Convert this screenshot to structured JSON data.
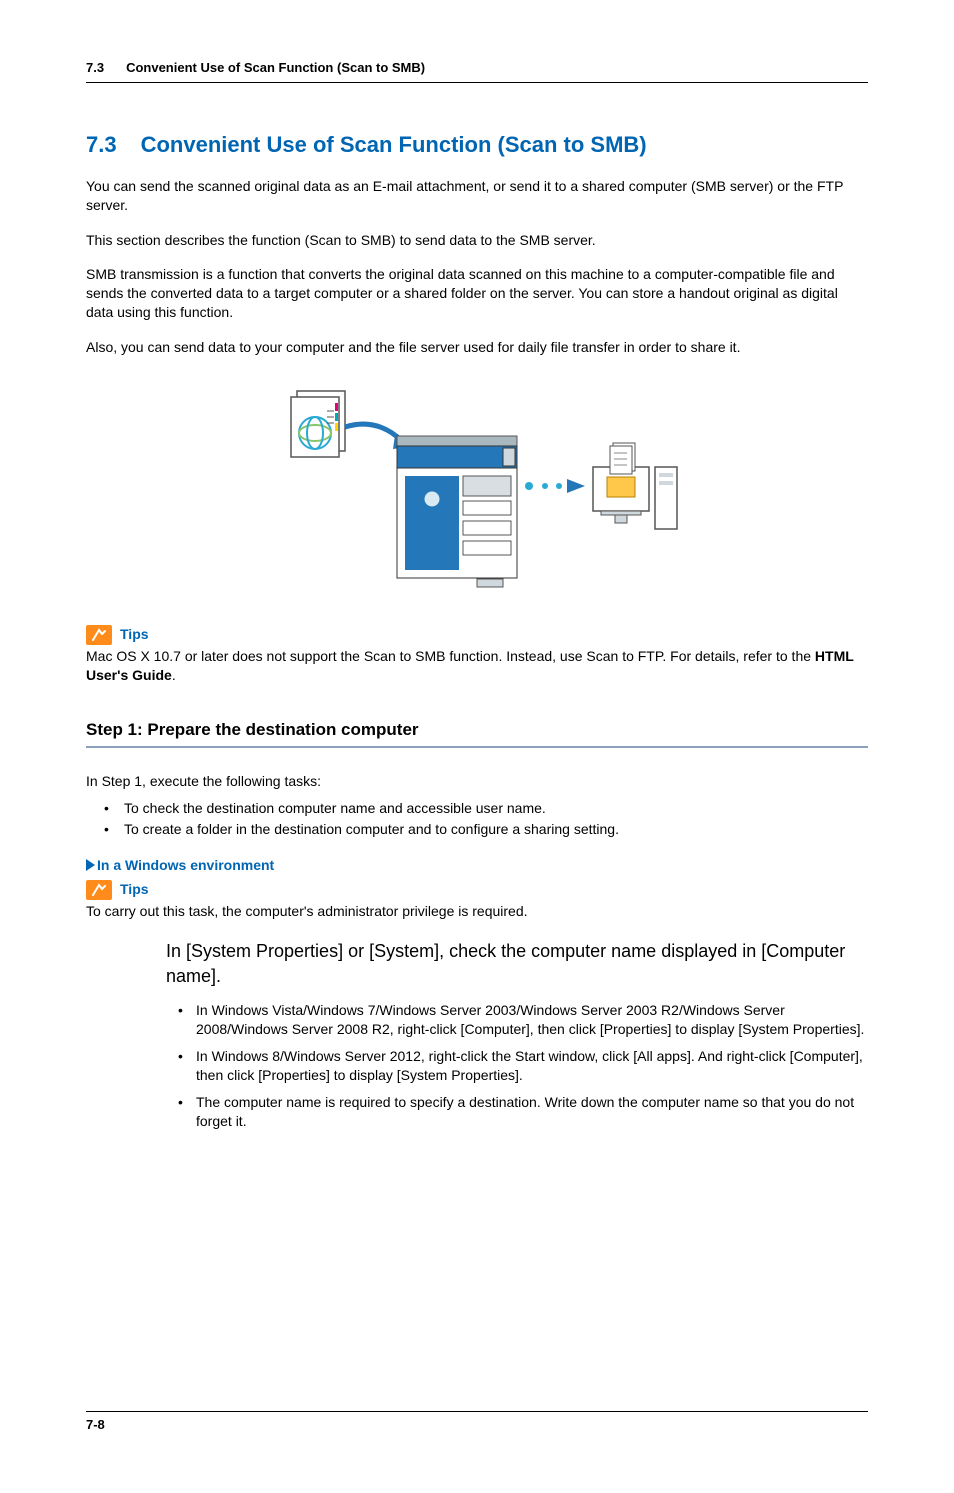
{
  "header": {
    "num": "7.3",
    "title": "Convenient Use of Scan Function (Scan to SMB)"
  },
  "section": {
    "num": "7.3",
    "title": "Convenient Use of Scan Function (Scan to SMB)"
  },
  "para1": "You can send the scanned original data as an E-mail attachment, or send it to a shared computer (SMB server) or the FTP server.",
  "para2": "This section describes the function (Scan to SMB) to send data to the SMB server.",
  "para3": "SMB transmission is a function that converts the original data scanned on this machine to a computer-compatible file and sends the converted data to a target computer or a shared folder on the server. You can store a handout original as digital data using this function.",
  "para4": "Also, you can send data to your computer and the file server used for daily file transfer in order to share it.",
  "tips1": {
    "label": "Tips",
    "text_a": "Mac OS X 10.7 or later does not support the Scan to SMB function. Instead, use Scan to FTP. For details, refer to the ",
    "text_b": "HTML User's Guide",
    "text_c": "."
  },
  "step1": {
    "heading": "Step 1: Prepare the destination computer",
    "intro": "In Step 1, execute the following tasks:",
    "bullets": [
      "To check the destination computer name and accessible user name.",
      "To create a folder in the destination computer and to configure a sharing setting."
    ]
  },
  "sub_a": {
    "title": "In a Windows environment"
  },
  "tips2": {
    "label": "Tips",
    "text": "To carry out this task, the computer's administrator privilege is required."
  },
  "instruction": "In [System Properties] or [System], check the computer name displayed in [Computer name].",
  "nested": [
    "In Windows Vista/Windows 7/Windows Server 2003/Windows Server 2003 R2/Windows Server 2008/Windows Server 2008 R2, right-click [Computer], then click [Properties] to display [System Properties].",
    "In Windows 8/Windows Server 2012, right-click the Start window, click [All apps]. And right-click [Computer], then click [Properties] to display [System Properties].",
    "The computer name is required to specify a destination. Write down the computer name so that you do not forget it."
  ],
  "footer": "7-8"
}
